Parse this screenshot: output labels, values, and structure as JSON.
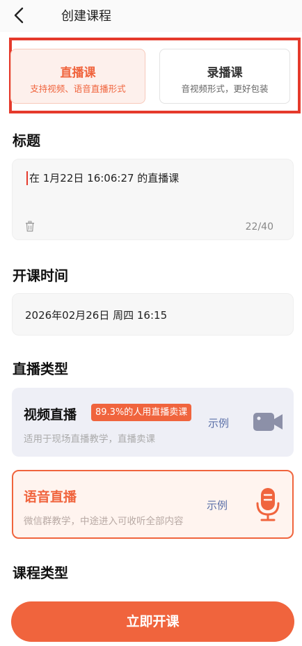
{
  "header": {
    "title": "创建课程"
  },
  "tabs": [
    {
      "title": "直播课",
      "subtitle": "支持视频、语音直播形式",
      "selected": true
    },
    {
      "title": "录播课",
      "subtitle": "音视频形式，更好包装",
      "selected": false
    }
  ],
  "sections": {
    "title_label": "标题",
    "time_label": "开课时间",
    "live_type_label": "直播类型",
    "course_type_label": "课程类型"
  },
  "title_input": {
    "value": "在 1月22日 16:06:27 的直播课",
    "counter": "22/40"
  },
  "start_time": {
    "value": "2026年02月26日 周四 16:15"
  },
  "live_types": [
    {
      "title": "视频直播",
      "badge": "89.3%的人用直播卖课",
      "description": "适用于现场直播教学，直播卖课",
      "example": "示例",
      "icon": "video-camera-icon",
      "selected": false
    },
    {
      "title": "语音直播",
      "description": "微信群教学，中途进入可收听全部内容",
      "example": "示例",
      "icon": "microphone-icon",
      "selected": true
    }
  ],
  "submit": {
    "label": "立即开课"
  },
  "colors": {
    "accent": "#f0643d",
    "highlight_outline": "#e53a2c",
    "link": "#5a6fa8"
  }
}
